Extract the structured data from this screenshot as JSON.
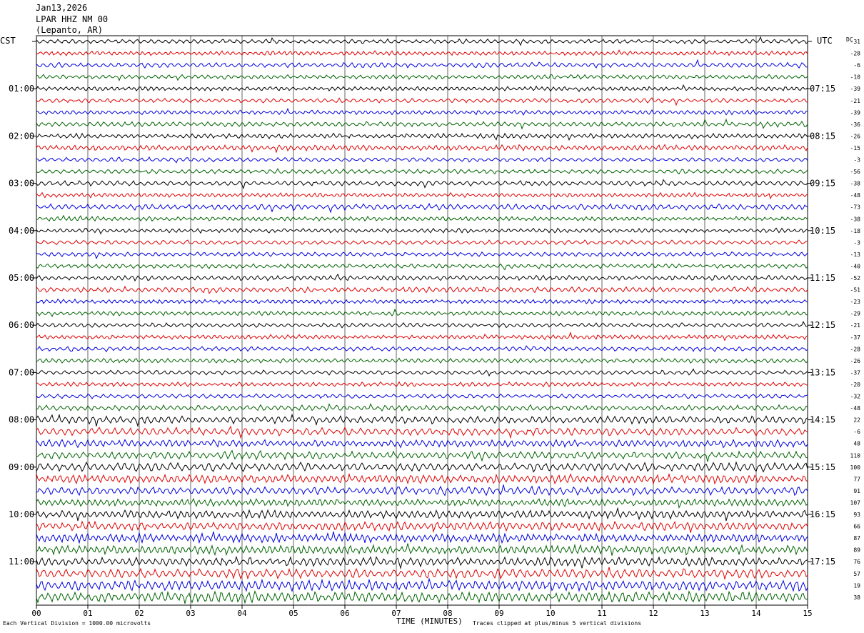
{
  "header": {
    "date": "Jan13,2026",
    "station": "LPAR HHZ NM 00",
    "location": "(Lepanto, AR)"
  },
  "left_axis_title": "CST",
  "right_axis_title": "UTC",
  "dc_title": "DC",
  "footer": {
    "left_note": "Each Vertical Division = 1000.00 microvolts",
    "xlabel": "TIME (MINUTES)",
    "right_note": "Traces clipped at plus/minus 5 vertical divisions"
  },
  "colors": [
    "#000000",
    "#e00000",
    "#0000e0",
    "#006400"
  ],
  "chart_data": {
    "type": "line",
    "title": "LPAR HHZ NM 00",
    "xlabel": "TIME (MINUTES)",
    "xlim": [
      0,
      15
    ],
    "x_ticks": [
      "00",
      "01",
      "02",
      "03",
      "04",
      "05",
      "06",
      "07",
      "08",
      "09",
      "10",
      "11",
      "12",
      "13",
      "14",
      "15"
    ],
    "left_time_labels": [
      "01:00",
      "02:00",
      "03:00",
      "04:00",
      "05:00",
      "06:00",
      "07:00",
      "08:00",
      "09:00",
      "10:00",
      "11:00"
    ],
    "right_time_labels": [
      "07:15",
      "08:15",
      "09:15",
      "10:15",
      "11:15",
      "12:15",
      "13:15",
      "14:15",
      "15:15",
      "16:15",
      "17:15"
    ],
    "dc_values": [
      "-31",
      "-28",
      "-6",
      "-10",
      "-39",
      "-21",
      "-39",
      "-36",
      "-26",
      "-15",
      "-3",
      "-56",
      "-38",
      "-48",
      "-73",
      "-38",
      "-18",
      "-3",
      "-13",
      "-40",
      "-52",
      "-51",
      "-23",
      "-29",
      "-21",
      "-37",
      "-28",
      "-26",
      "-37",
      "-20",
      "-32",
      "-48",
      "22",
      "-6",
      "48",
      "110",
      "100",
      "77",
      "91",
      "107",
      "93",
      "66",
      "87",
      "89",
      "76",
      "57",
      "19",
      "38"
    ],
    "trace_amplitude": [
      0.35,
      0.35,
      0.4,
      0.35,
      0.35,
      0.35,
      0.35,
      0.4,
      0.4,
      0.45,
      0.35,
      0.35,
      0.4,
      0.35,
      0.45,
      0.35,
      0.35,
      0.35,
      0.35,
      0.35,
      0.4,
      0.45,
      0.35,
      0.35,
      0.35,
      0.35,
      0.35,
      0.35,
      0.35,
      0.35,
      0.35,
      0.45,
      0.6,
      0.6,
      0.6,
      0.6,
      0.7,
      0.7,
      0.65,
      0.6,
      0.65,
      0.7,
      0.7,
      0.7,
      0.7,
      0.75,
      0.8,
      0.85
    ]
  }
}
